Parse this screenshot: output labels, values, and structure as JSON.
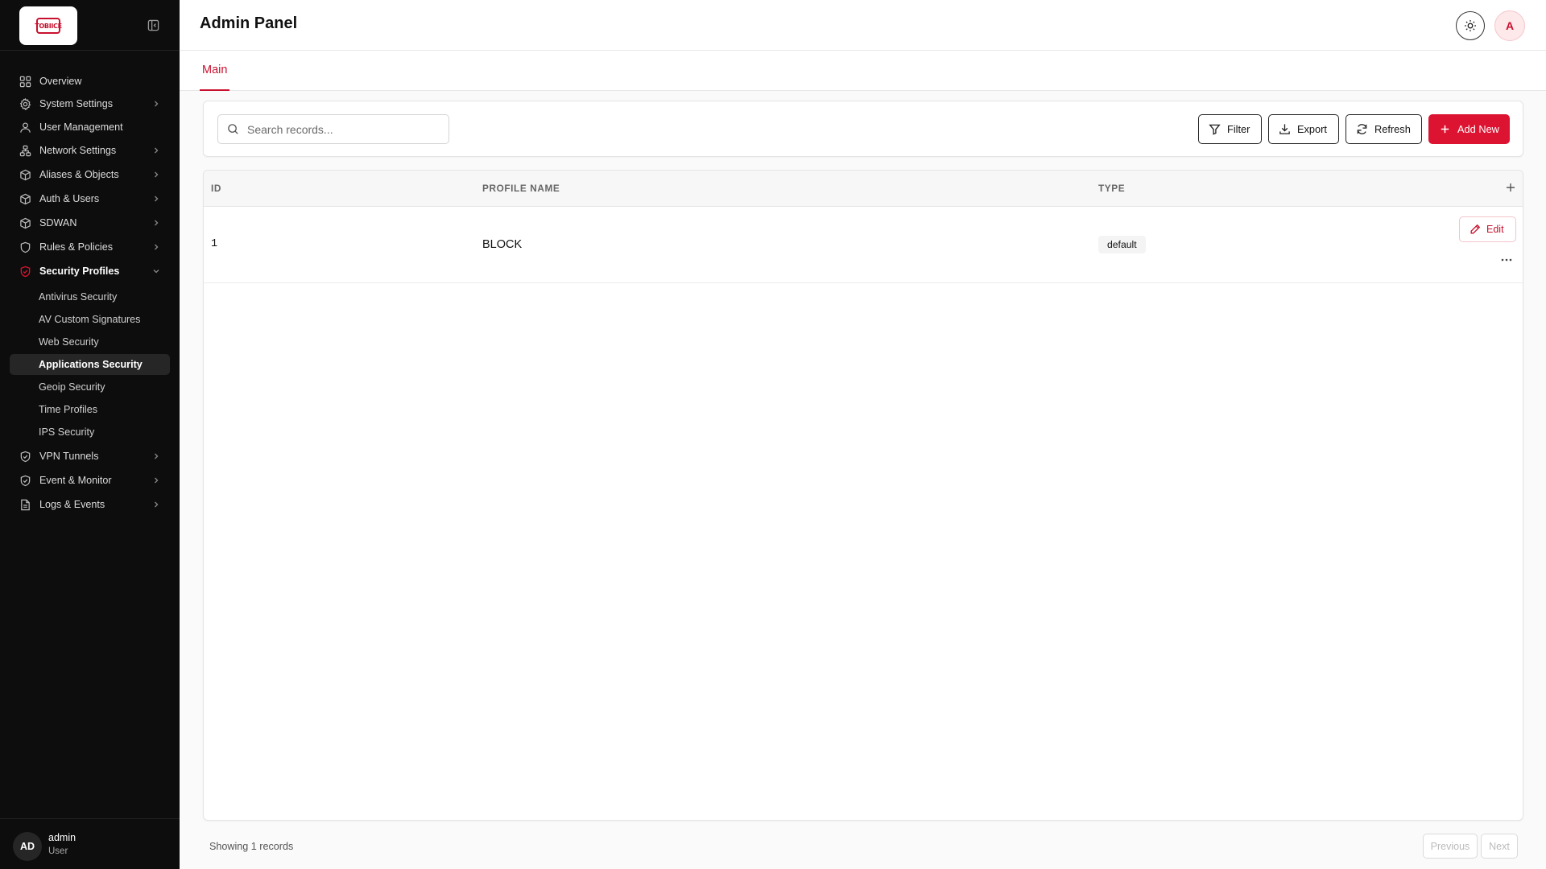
{
  "app": {
    "logo_text": "TOBIICE"
  },
  "header": {
    "title": "Admin Panel",
    "avatar_initial": "A"
  },
  "sidebar": {
    "items": [
      {
        "label": "Overview",
        "icon": "grid-icon",
        "has_children": false
      },
      {
        "label": "System Settings",
        "icon": "gear-icon",
        "has_children": true
      },
      {
        "label": "User Management",
        "icon": "user-icon",
        "has_children": false
      },
      {
        "label": "Network Settings",
        "icon": "network-icon",
        "has_children": true
      },
      {
        "label": "Aliases & Objects",
        "icon": "box-icon",
        "has_children": true
      },
      {
        "label": "Auth & Users",
        "icon": "box-icon",
        "has_children": true
      },
      {
        "label": "SDWAN",
        "icon": "box-icon",
        "has_children": true
      },
      {
        "label": "Rules & Policies",
        "icon": "shield-icon",
        "has_children": true
      },
      {
        "label": "Security Profiles",
        "icon": "shield-check-icon",
        "has_children": true,
        "expanded": true
      },
      {
        "label": "VPN Tunnels",
        "icon": "shield-check-icon",
        "has_children": true
      },
      {
        "label": "Event & Monitor",
        "icon": "shield-check-icon",
        "has_children": true
      },
      {
        "label": "Logs & Events",
        "icon": "file-icon",
        "has_children": true
      }
    ],
    "sub_items": [
      {
        "label": "Antivirus Security"
      },
      {
        "label": "AV Custom Signatures"
      },
      {
        "label": "Web Security"
      },
      {
        "label": "Applications Security",
        "selected": true
      },
      {
        "label": "Geoip Security"
      },
      {
        "label": "Time Profiles"
      },
      {
        "label": "IPS Security"
      }
    ],
    "user": {
      "initials": "AD",
      "name": "admin",
      "role": "User"
    }
  },
  "tabs": [
    {
      "label": "Main",
      "active": true
    }
  ],
  "toolbar": {
    "search_placeholder": "Search records...",
    "filter_label": "Filter",
    "export_label": "Export",
    "refresh_label": "Refresh",
    "add_label": "Add New"
  },
  "table": {
    "columns": [
      "ID",
      "PROFILE NAME",
      "TYPE"
    ],
    "rows": [
      {
        "id": "1",
        "profile_name": "BLOCK",
        "type": "default"
      }
    ],
    "edit_label": "Edit"
  },
  "footer": {
    "status": "Showing 1 records",
    "prev_label": "Previous",
    "next_label": "Next"
  },
  "colors": {
    "accent": "#dc1431",
    "sidebar_bg": "#0d0d0d"
  }
}
